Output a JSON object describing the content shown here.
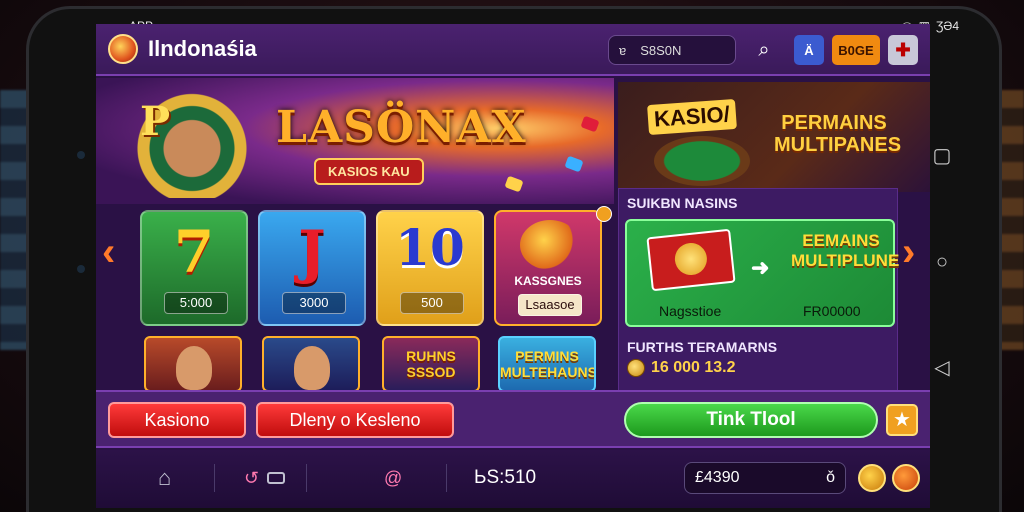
{
  "status_bar": {
    "app": "APP",
    "time": "ƷƏ4"
  },
  "topbar": {
    "brand": "Ilndonaśia",
    "search_value": "S8S0N",
    "search_prefix": "ɐ",
    "az_label": "Ä",
    "coins_label": "B0GE",
    "flag_label": "✚"
  },
  "hero": {
    "title": "LASÖNAX",
    "subtitle": "KASIOS KAU"
  },
  "promo": {
    "kasio": "KASIO/",
    "permains": "PERMAINS MULTIPANES"
  },
  "side_panel": {
    "title": "SUIKBN NASINS",
    "card_label_left": "Nagsstioe",
    "card_label_right": "FR00000",
    "card_title": "EEMAINS MULTIPLUNE",
    "sub_title": "FURTHS TERAMARNS",
    "jackpot": "16 000 13.2"
  },
  "tiles": [
    {
      "big": "7",
      "price": "5:000"
    },
    {
      "big": "J",
      "price": "3000"
    },
    {
      "big": "10",
      "price": "500"
    },
    {
      "name": "KASSGNES",
      "price": "Lsaasoe"
    }
  ],
  "minis": [
    {
      "text": ""
    },
    {
      "text": ""
    },
    {
      "text": "RUHNS SSSOD"
    },
    {
      "text": "PERMINS MULTEHAUNS"
    }
  ],
  "actions": {
    "kasiono": "Kasiono",
    "dleny": "Dleny o Kesleno",
    "tink": "Tink Tlool",
    "star": "★"
  },
  "bottom_nav": {
    "code": "ЬS:510",
    "balance": "£4390",
    "balance_suffix": "ǒ"
  }
}
